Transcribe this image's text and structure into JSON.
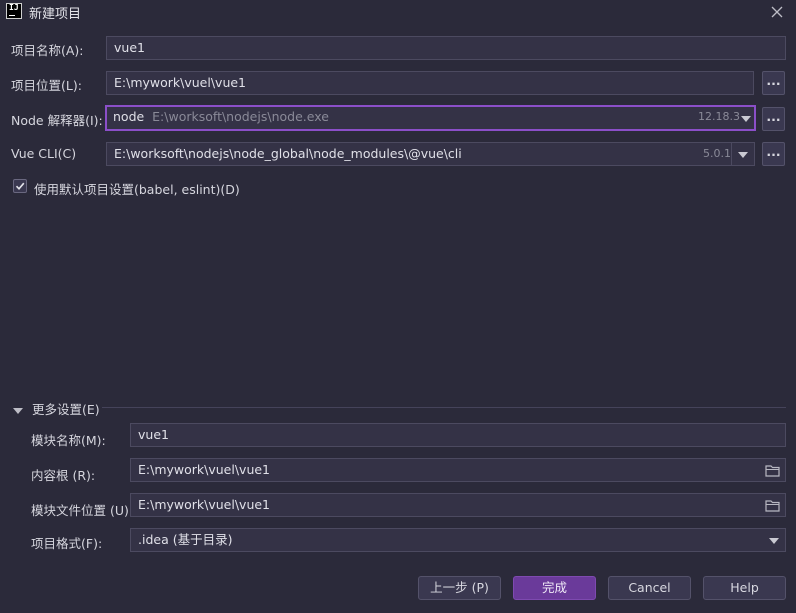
{
  "window": {
    "icon_text": "IJ",
    "title": "新建项目"
  },
  "form": {
    "project_name_label": "项目名称(A):",
    "project_name_value": "vue1",
    "project_location_label": "项目位置(L):",
    "project_location_value": "E:\\mywork\\vuel\\vue1",
    "node_label": "Node 解释器(I):",
    "node_name": "node",
    "node_path": "E:\\worksoft\\nodejs\\node.exe",
    "node_version": "12.18.3",
    "vue_cli_label": "Vue CLI(C)",
    "vue_cli_value": "E:\\worksoft\\nodejs\\node_global\\node_modules\\@vue\\cli",
    "vue_cli_version": "5.0.1",
    "browse_label": "...",
    "default_settings_label": "使用默认项目设置(babel, eslint)(D)",
    "default_settings_checked": true
  },
  "more": {
    "header": "更多设置(E)",
    "module_name_label": "模块名称(M):",
    "module_name_value": "vue1",
    "content_root_label": "内容根 (R):",
    "content_root_value": "E:\\mywork\\vuel\\vue1",
    "module_file_label": "模块文件位置 (U):",
    "module_file_value": "E:\\mywork\\vuel\\vue1",
    "project_format_label": "项目格式(F):",
    "project_format_value": ".idea (基于目录)"
  },
  "buttons": {
    "previous": "上一步 (P)",
    "finish": "完成",
    "cancel": "Cancel",
    "help": "Help"
  },
  "colors": {
    "background": "#2b2a3a",
    "field": "#343246",
    "focus_border": "#8b4fc9",
    "primary_button": "#6a3a9a"
  },
  "icons": [
    "close-icon",
    "folder-icon",
    "chevron-down-icon",
    "checkmark-icon",
    "triangle-down-icon"
  ]
}
